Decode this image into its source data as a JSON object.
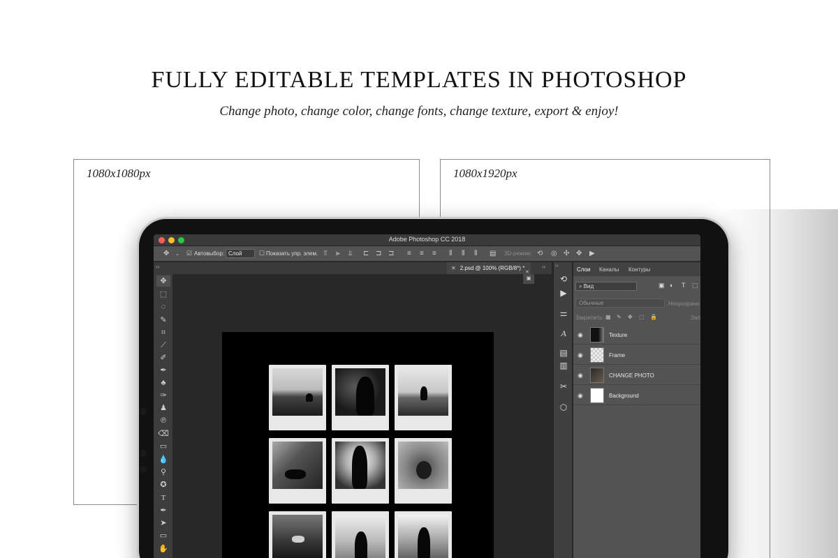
{
  "heading": "FULLY EDITABLE TEMPLATES IN PHOTOSHOP",
  "subheading": "Change photo, change color, change fonts, change texture, export & enjoy!",
  "cards": [
    {
      "label": "1080x1080px"
    },
    {
      "label": "1080x1920px"
    }
  ],
  "app": {
    "title": "Adobe Photoshop CC 2018",
    "options": {
      "autoselect_label": "Автовыбор:",
      "autoselect_value": "Слой",
      "show_controls_label": "Показать упр. элем.",
      "mode_3d_label": "3D-режим:"
    },
    "document_tab": "2.psd @ 100% (RGB/8*) *",
    "layers_panel": {
      "tabs": [
        "Слои",
        "Каналы",
        "Контуры"
      ],
      "filter_placeholder": "Вид",
      "blend_mode": "Обычные",
      "opacity_label": "Непрозрачн",
      "lock_label": "Закрепить:",
      "fill_label": "Зал",
      "layers": [
        {
          "name": "Texture"
        },
        {
          "name": "Frame"
        },
        {
          "name": "CHANGE PHOTO"
        },
        {
          "name": "Background"
        }
      ]
    }
  },
  "colors": {
    "close": "#fe5f57",
    "minimize": "#febc2e",
    "maximize": "#28c840"
  }
}
